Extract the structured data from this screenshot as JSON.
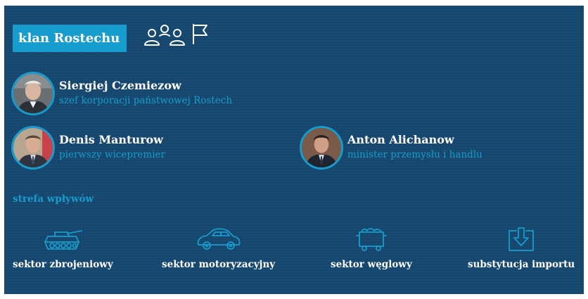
{
  "header": {
    "title": "klan Rostechu",
    "icon": "group-flag-icon"
  },
  "people": [
    {
      "name": "Siergiej Czemiezow",
      "role": "szef korporacji państwowej Rostech"
    },
    {
      "name": "Denis Manturow",
      "role": "pierwszy wicepremier"
    },
    {
      "name": "Anton Alichanow",
      "role": "minister przemysłu i handlu"
    }
  ],
  "influence": {
    "label": "strefa wpływów",
    "sectors": [
      {
        "label": "sektor zbrojeniowy",
        "icon": "tank-icon"
      },
      {
        "label": "sektor motoryzacyjny",
        "icon": "car-icon"
      },
      {
        "label": "sektor węglowy",
        "icon": "coal-cart-icon"
      },
      {
        "label": "substytucja importu",
        "icon": "import-box-icon"
      }
    ]
  },
  "colors": {
    "background": "#16476e",
    "accent": "#169ccd",
    "text": "#ffffff"
  }
}
